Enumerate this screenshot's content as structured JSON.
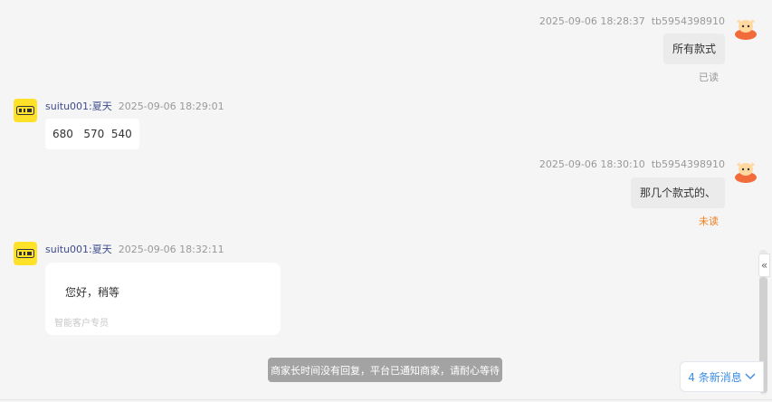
{
  "messages": [
    {
      "time": "2025-09-06 18:28:37",
      "sender": "tb5954398910",
      "text": "所有款式",
      "status": "已读"
    },
    {
      "time": "2025-09-06 18:29:01",
      "sender": "suitu001:夏天",
      "text": "680   570  540"
    },
    {
      "time": "2025-09-06 18:30:10",
      "sender": "tb5954398910",
      "text": "那几个款式的、",
      "status": "未读"
    },
    {
      "time": "2025-09-06 18:32:11",
      "sender": "suitu001:夏天",
      "text": "您好，稍等",
      "sub": "智能客户专员"
    }
  ],
  "notice": "商家长时间没有回复，平台已通知商家，请耐心等待",
  "new_messages": "4 条新消息",
  "collapse_glyph": "«",
  "colors": {
    "unread": "#f07f1e",
    "accent": "#3b8de6",
    "shop_avatar": "#ffe12a"
  }
}
